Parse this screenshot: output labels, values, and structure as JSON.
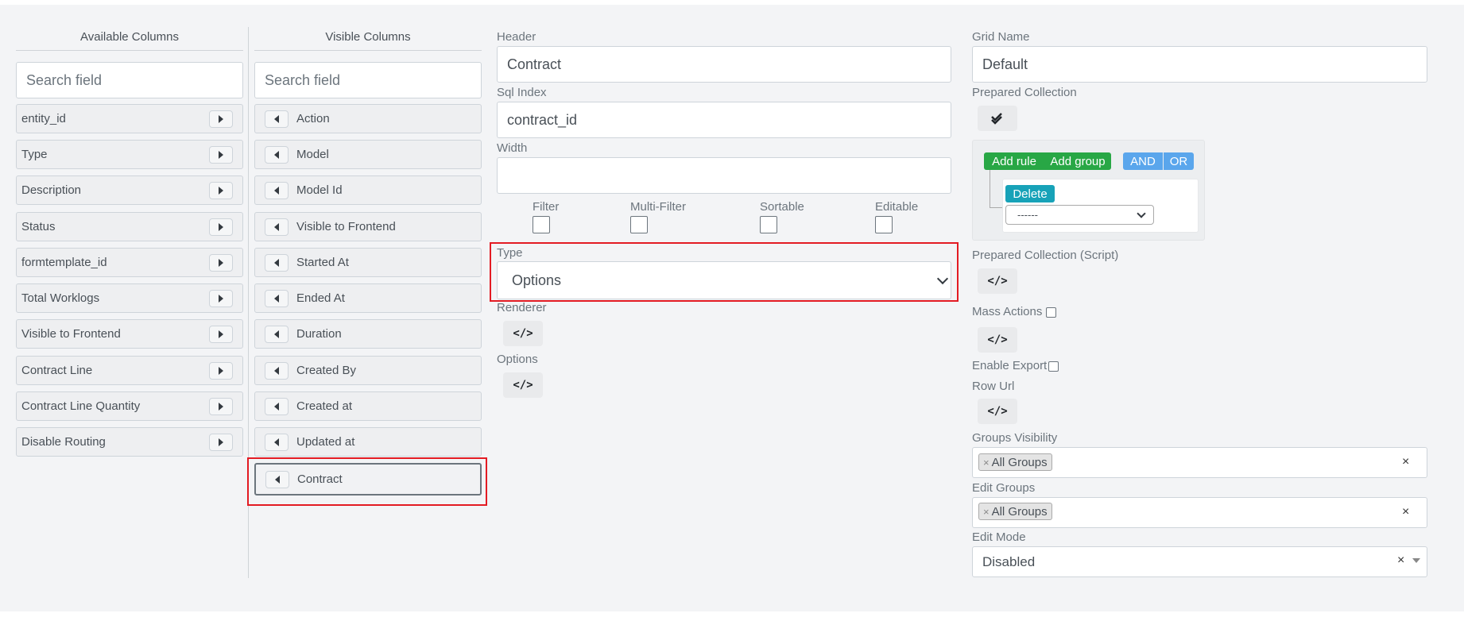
{
  "available": {
    "title": "Available Columns",
    "search_placeholder": "Search field",
    "items": [
      "entity_id",
      "Type",
      "Description",
      "Status",
      "formtemplate_id",
      "Total Worklogs",
      "Visible to Frontend",
      "Contract Line",
      "Contract Line Quantity",
      "Disable Routing"
    ]
  },
  "visible": {
    "title": "Visible Columns",
    "search_placeholder": "Search field",
    "items": [
      "Action",
      "Model",
      "Model Id",
      "Visible to Frontend",
      "Started At",
      "Ended At",
      "Duration",
      "Created By",
      "Created at",
      "Updated at",
      "Contract"
    ],
    "selected": "Contract"
  },
  "column_settings": {
    "header_label": "Header",
    "header_value": "Contract",
    "sql_index_label": "Sql Index",
    "sql_index_value": "contract_id",
    "width_label": "Width",
    "width_value": "",
    "filter_label": "Filter",
    "multi_filter_label": "Multi-Filter",
    "sortable_label": "Sortable",
    "editable_label": "Editable",
    "type_label": "Type",
    "type_value": "Options",
    "renderer_label": "Renderer",
    "options_label": "Options",
    "code_icon": "</>"
  },
  "grid_settings": {
    "grid_name_label": "Grid Name",
    "grid_name_value": "Default",
    "prepared_collection_label": "Prepared Collection",
    "query_builder": {
      "add_rule": "Add rule",
      "add_group": "Add group",
      "and": "AND",
      "or": "OR",
      "delete": "Delete",
      "rule_select": "------"
    },
    "prepared_collection_script_label": "Prepared Collection (Script)",
    "mass_actions_label": "Mass Actions",
    "enable_export_label": "Enable Export",
    "row_url_label": "Row Url",
    "groups_visibility_label": "Groups Visibility",
    "groups_visibility_tag": "All Groups",
    "edit_groups_label": "Edit Groups",
    "edit_groups_tag": "All Groups",
    "edit_mode_label": "Edit Mode",
    "edit_mode_value": "Disabled",
    "clear_symbol": "×",
    "code_icon": "</>"
  },
  "colors": {
    "highlight": "#e31b23",
    "add_button": "#28a745",
    "and_or": "#5aa6ec",
    "delete": "#17a2b8"
  }
}
